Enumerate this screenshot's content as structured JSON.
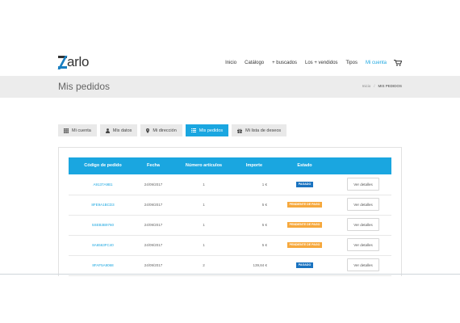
{
  "brand": {
    "logo_text": "arlo"
  },
  "nav": {
    "items": [
      "Inicio",
      "Catálogo",
      "+ buscados",
      "Los + vendidos",
      "Tipos",
      "Mi cuenta"
    ],
    "active_index": 5
  },
  "page": {
    "title": "Mis pedidos"
  },
  "breadcrumb": {
    "home": "Inicio",
    "separator": "/",
    "current": "MIS PEDIDOS"
  },
  "tabs": [
    {
      "label": "Mi cuenta",
      "icon": "grid-icon"
    },
    {
      "label": "Mis datos",
      "icon": "user-icon"
    },
    {
      "label": "Mi dirección",
      "icon": "map-marker-icon"
    },
    {
      "label": "Mis pedidos",
      "icon": "list-icon"
    },
    {
      "label": "Mi lista de deseos",
      "icon": "gift-icon"
    }
  ],
  "active_tab": 3,
  "table": {
    "headers": [
      "Código de pedido",
      "Fecha",
      "Número artículos",
      "Importe",
      "Estado"
    ],
    "rows": [
      {
        "code": "A9137A9B1",
        "date": "24/09/2017",
        "items": "1",
        "amount": "1 €",
        "status": "PAGADO",
        "status_color": "#1a73c0",
        "action": "Ver detalles"
      },
      {
        "code": "8FE9A1BCD3",
        "date": "24/09/2017",
        "items": "1",
        "amount": "5 €",
        "status": "PENDIENTE DE PAGO",
        "status_color": "#f6a83c",
        "action": "Ver detalles"
      },
      {
        "code": "5SEB3B9760",
        "date": "24/09/2017",
        "items": "1",
        "amount": "5 €",
        "status": "PENDIENTE DE PAGO",
        "status_color": "#f6a83c",
        "action": "Ver detalles"
      },
      {
        "code": "8A6563FC40",
        "date": "24/09/2017",
        "items": "1",
        "amount": "5 €",
        "status": "PENDIENTE DE PAGO",
        "status_color": "#f6a83c",
        "action": "Ver detalles"
      },
      {
        "code": "8FAF5A9068",
        "date": "24/09/2017",
        "items": "2",
        "amount": "139,84 €",
        "status": "PAGADO",
        "status_color": "#1a73c0",
        "action": "Ver detalles"
      }
    ]
  },
  "colors": {
    "accent": "#1aa6e0",
    "paid": "#1a73c0",
    "pending": "#f6a83c"
  }
}
